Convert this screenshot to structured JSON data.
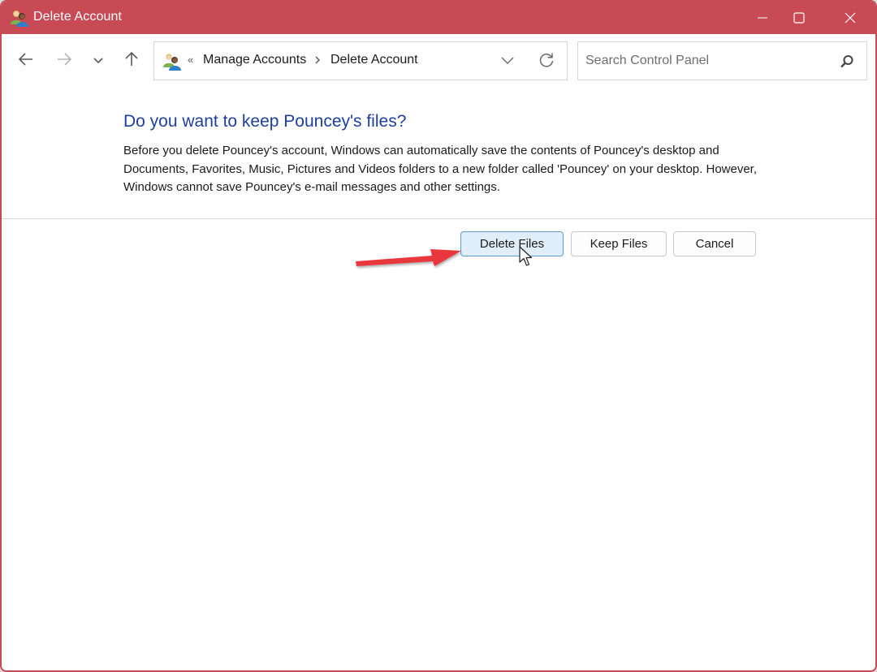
{
  "window": {
    "title": "Delete Account",
    "title_icon": "user-accounts-icon",
    "controls": {
      "minimize": "minimize-icon",
      "maximize": "maximize-icon",
      "close": "close-icon"
    },
    "titlebar_color": "#c74a54"
  },
  "navigation": {
    "back": "arrow-left-icon",
    "forward": "arrow-right-icon",
    "recent": "chevron-down-icon",
    "up": "arrow-up-icon"
  },
  "address_bar": {
    "overflow_glyph": "«",
    "breadcrumbs": [
      {
        "label": "Manage Accounts"
      },
      {
        "label": "Delete Account"
      }
    ],
    "separator_icon": "chevron-right-icon",
    "dropdown_icon": "chevron-down-icon",
    "refresh_icon": "refresh-icon"
  },
  "search": {
    "placeholder": "Search Control Panel",
    "value": "",
    "icon": "search-icon"
  },
  "content": {
    "heading": "Do you want to keep Pouncey's files?",
    "description": "Before you delete Pouncey's account, Windows can automatically save the contents of Pouncey's desktop and Documents, Favorites, Music, Pictures and Videos folders to a new folder called 'Pouncey' on your desktop. However, Windows cannot save Pouncey's e-mail messages and other settings.",
    "heading_color": "#1e3f9e"
  },
  "buttons": {
    "delete_files": "Delete Files",
    "keep_files": "Keep Files",
    "cancel": "Cancel"
  },
  "annotation": {
    "arrow_color": "#e8383d",
    "points_to": "Delete Files"
  }
}
